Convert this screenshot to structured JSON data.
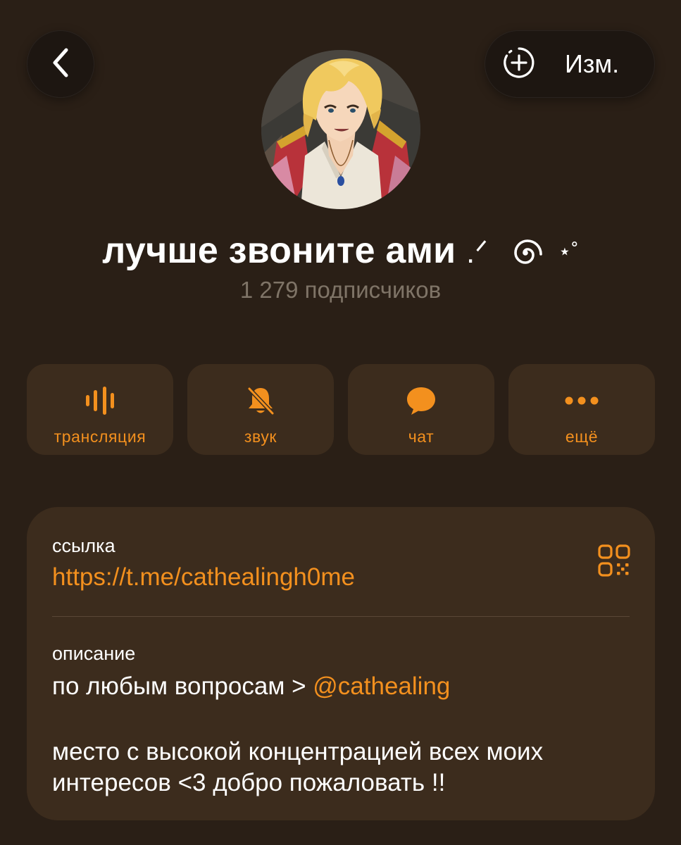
{
  "header": {
    "edit_label": "Изм."
  },
  "channel": {
    "title": "лучше звоните ами",
    "title_decoration_1": ".ᐟ",
    "title_decoration_2": "⋆˚",
    "subscribers": "1 279 подписчиков"
  },
  "actions": [
    {
      "label": "трансляция",
      "icon": "live-stream-icon"
    },
    {
      "label": "звук",
      "icon": "bell-muted-icon"
    },
    {
      "label": "чат",
      "icon": "chat-bubble-icon"
    },
    {
      "label": "ещё",
      "icon": "more-dots-icon"
    }
  ],
  "info": {
    "link_caption": "ссылка",
    "link_value": "https://t.me/cathealingh0me",
    "description_caption": "описание",
    "description_line1_prefix": "по любым вопросам > ",
    "description_mention": "@cathealing",
    "description_line2": "место с высокой концентрацией всех моих",
    "description_line3": "интересов <3 добро пожаловать !!"
  },
  "colors": {
    "background": "#2a1f16",
    "card": "#3c2c1d",
    "accent": "#f3901e",
    "muted_text": "#7f7467"
  }
}
